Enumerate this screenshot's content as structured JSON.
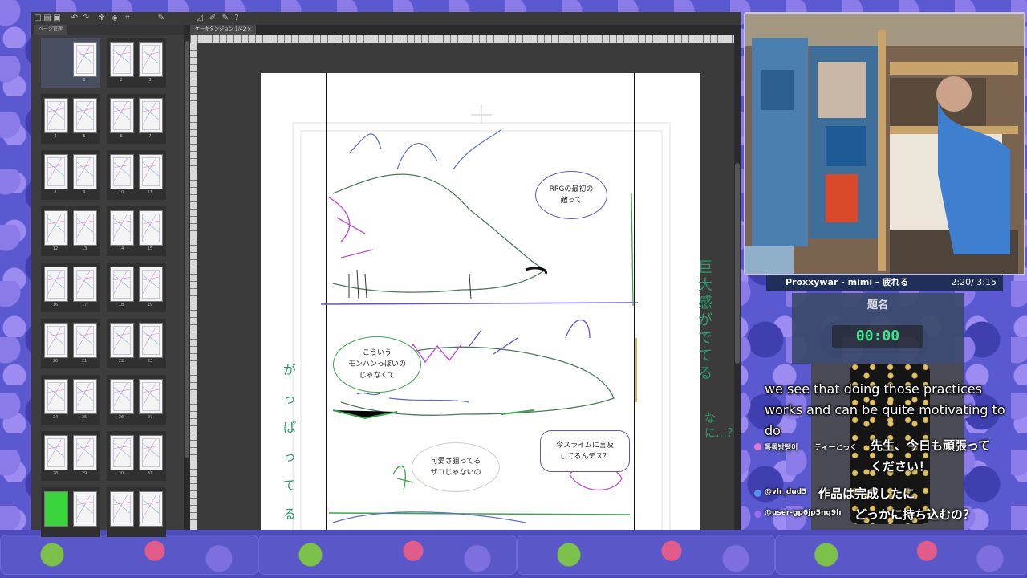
{
  "app": {
    "panel_tab_label": "ページ管理",
    "document_tab_label": "ケーキダンジョン 1/42",
    "page_thumbnails": [
      {
        "pages": [
          "1"
        ],
        "selected": true
      },
      {
        "pages": [
          "2",
          "3"
        ]
      },
      {
        "pages": [
          "4",
          "5"
        ]
      },
      {
        "pages": [
          "6",
          "7"
        ]
      },
      {
        "pages": [
          "8",
          "9"
        ]
      },
      {
        "pages": [
          "10",
          "11"
        ]
      },
      {
        "pages": [
          "12",
          "13"
        ]
      },
      {
        "pages": [
          "14",
          "15"
        ]
      },
      {
        "pages": [
          "16",
          "17"
        ]
      },
      {
        "pages": [
          "18",
          "19"
        ]
      },
      {
        "pages": [
          "20",
          "21"
        ]
      },
      {
        "pages": [
          "22",
          "23"
        ]
      },
      {
        "pages": [
          "24",
          "25"
        ]
      },
      {
        "pages": [
          "26",
          "27"
        ]
      },
      {
        "pages": [
          "28",
          "29"
        ]
      },
      {
        "pages": [
          "30",
          "31"
        ]
      },
      {
        "pages": [
          "",
          ""
        ],
        "first_green": true
      },
      {
        "pages": [
          "",
          ""
        ]
      }
    ],
    "toolbar_icons": [
      "new-file-icon",
      "open-icon",
      "save-icon",
      "undo-icon",
      "redo-icon",
      "settings-icon",
      "fill-icon",
      "crop-icon",
      "pen-icon",
      "ruler-icon",
      "brush-icon"
    ]
  },
  "canvas": {
    "bubbles": [
      {
        "text": "RPGの最初の\n敵って",
        "color": "#6a4fc0"
      },
      {
        "text": "こういう\nモンハンっぽいの\nじゃなくて",
        "color": "#3aa54a"
      },
      {
        "text": "可愛さ狙ってる\nザコじゃないの",
        "color": "#cfcfcf"
      },
      {
        "text": "今スライムに言及\nしてるんデス？",
        "color": "#6a4fc0"
      }
    ],
    "margin_notes": [
      "巨大感がでてる",
      "なに…？",
      "がっぱってるで"
    ]
  },
  "stream": {
    "now_playing": {
      "title": "Proxxywar - mimi - 疲れる",
      "time": "2:20/ 3:15"
    },
    "timer": {
      "title": "題名",
      "value": "00:00"
    },
    "caption": "we see that doing those practices works and can be quite motivating to do",
    "chat": [
      {
        "user": "톡톡방탱이",
        "extra_user": "ティーとっく",
        "message": "先生、今日も頑張ってください！",
        "dot_color": "#e07ad0"
      },
      {
        "user": "@vlr_dud5",
        "message": "作品は完成したに",
        "dot_color": "#5a8ef0"
      },
      {
        "user": "@user-gp6jp5nq9h",
        "message": "どっかに持ち込むの？",
        "dot_color": "#9a6af0"
      }
    ]
  }
}
